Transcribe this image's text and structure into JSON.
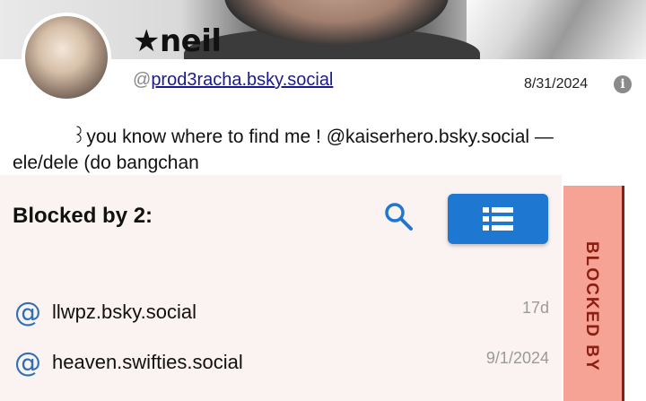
{
  "profile": {
    "display_name": "★neil",
    "handle_prefix": "@",
    "handle": "prod3racha.bsky.social",
    "date": "8/31/2024",
    "bio_line1": "꒱you know where to find me !  @kaiserhero.bsky.social —",
    "bio_line2": "ele/dele (do bangchan"
  },
  "panel": {
    "title": "Blocked by 2:",
    "tab_label": "BLOCKED BY",
    "rows": [
      {
        "handle": "llwpz.bsky.social",
        "time": "17d"
      },
      {
        "handle": "heaven.swifties.social",
        "time": "9/1/2024"
      }
    ]
  },
  "icons": {
    "info": "info-icon",
    "search": "search-icon",
    "list": "list-icon",
    "at": "at-icon"
  },
  "colors": {
    "accent": "#1e78d2",
    "tab": "#f6a396",
    "tab_text": "#8b1f12",
    "panel_bg": "#fbf3f1"
  }
}
